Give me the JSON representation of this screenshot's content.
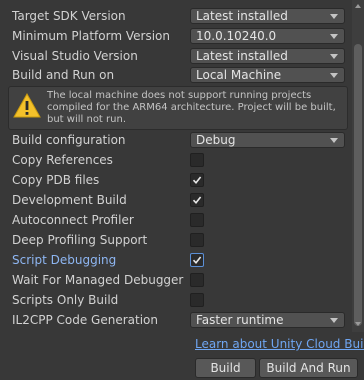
{
  "settings": {
    "target_sdk": {
      "label": "Target SDK Version",
      "value": "Latest installed"
    },
    "min_platform": {
      "label": "Minimum Platform Version",
      "value": "10.0.10240.0"
    },
    "visual_studio": {
      "label": "Visual Studio Version",
      "value": "Latest installed"
    },
    "build_and_run_on": {
      "label": "Build and Run on",
      "value": "Local Machine"
    },
    "warning": "The local machine does not support running projects compiled for the ARM64 architecture. Project will be built, but will not run.",
    "build_configuration": {
      "label": "Build configuration",
      "value": "Debug"
    },
    "checkboxes": [
      {
        "label": "Copy References",
        "checked": false
      },
      {
        "label": "Copy PDB files",
        "checked": true
      },
      {
        "label": "Development Build",
        "checked": true
      },
      {
        "label": "Autoconnect Profiler",
        "checked": false
      },
      {
        "label": "Deep Profiling Support",
        "checked": false
      },
      {
        "label": "Script Debugging",
        "checked": true
      },
      {
        "label": "Wait For Managed Debugger",
        "checked": false
      },
      {
        "label": "Scripts Only Build",
        "checked": false
      }
    ],
    "il2cpp": {
      "label": "IL2CPP Code Generation",
      "value": "Faster runtime"
    }
  },
  "footer": {
    "learn_link": "Learn about Unity Cloud Build",
    "build_button": "Build",
    "build_and_run_button": "Build And Run"
  },
  "colors": {
    "background": "#383838",
    "link": "#6fa6f2",
    "focus": "#5b8fd6"
  }
}
